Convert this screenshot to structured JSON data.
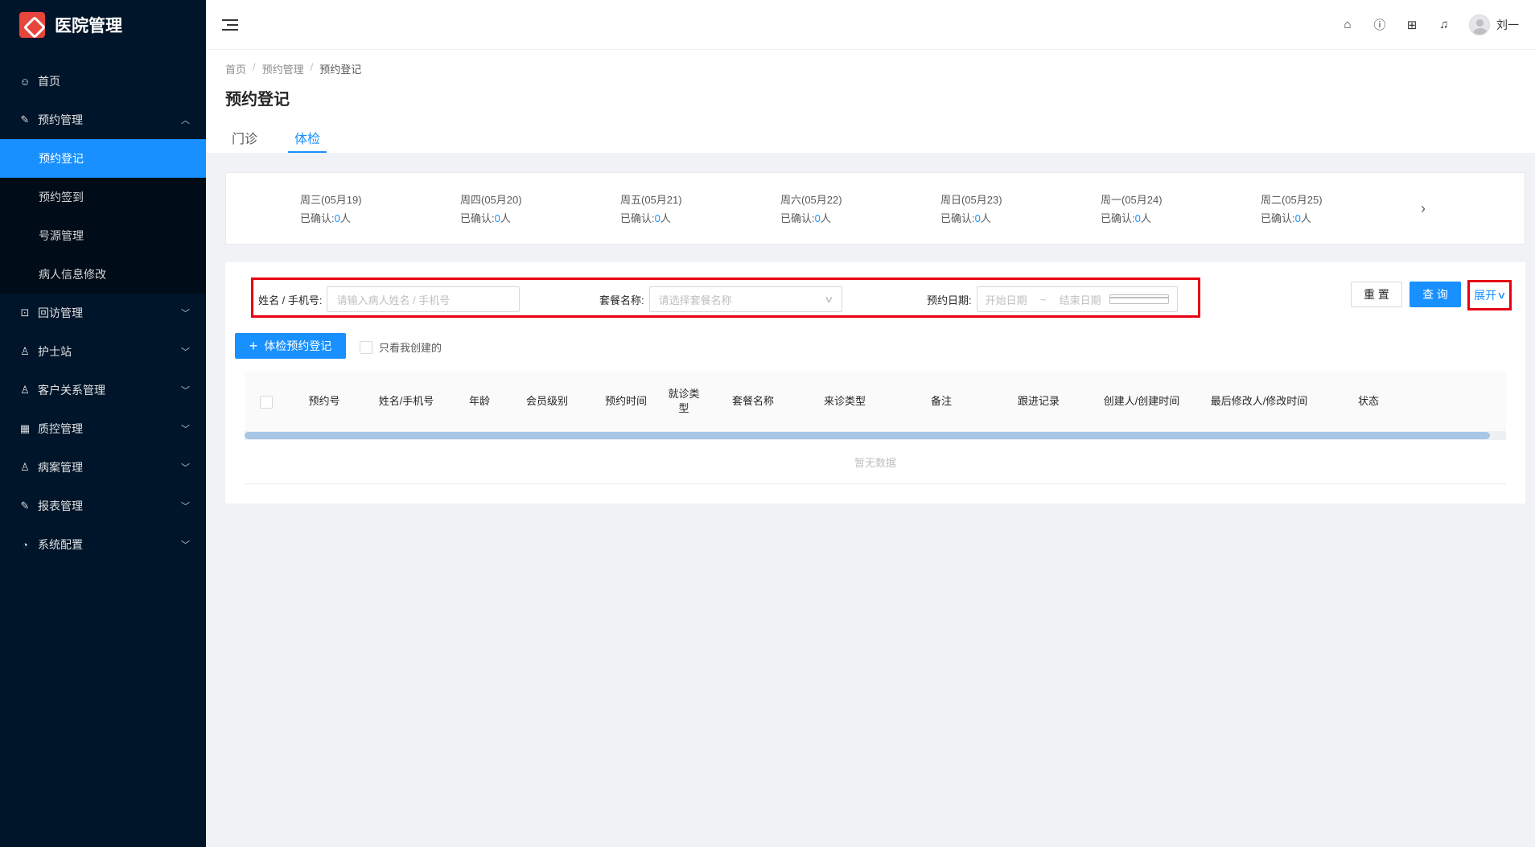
{
  "app": {
    "title": "医院管理"
  },
  "sidebar": {
    "items": [
      {
        "label": "首页",
        "icon": "smile-icon"
      },
      {
        "label": "预约管理",
        "icon": "edit-icon",
        "expanded": true,
        "children": [
          {
            "label": "预约登记",
            "active": true
          },
          {
            "label": "预约签到"
          },
          {
            "label": "号源管理"
          },
          {
            "label": "病人信息修改"
          }
        ]
      },
      {
        "label": "回访管理",
        "icon": "lock-icon"
      },
      {
        "label": "护士站",
        "icon": "user-icon"
      },
      {
        "label": "客户关系管理",
        "icon": "user-icon"
      },
      {
        "label": "质控管理",
        "icon": "table-icon"
      },
      {
        "label": "病案管理",
        "icon": "user-icon"
      },
      {
        "label": "报表管理",
        "icon": "edit-icon"
      },
      {
        "label": "系统配置",
        "icon": "dashboard-icon"
      }
    ]
  },
  "header": {
    "username": "刘一"
  },
  "breadcrumb": [
    "首页",
    "预约管理",
    "预约登记"
  ],
  "page_title": "预约登记",
  "tabs": [
    {
      "label": "门诊",
      "active": false
    },
    {
      "label": "体检",
      "active": true
    }
  ],
  "dates": [
    {
      "label": "周三(05月19)",
      "confirmed_prefix": "已确认:",
      "count": "0",
      "unit": "人"
    },
    {
      "label": "周四(05月20)",
      "confirmed_prefix": "已确认:",
      "count": "0",
      "unit": "人"
    },
    {
      "label": "周五(05月21)",
      "confirmed_prefix": "已确认:",
      "count": "0",
      "unit": "人"
    },
    {
      "label": "周六(05月22)",
      "confirmed_prefix": "已确认:",
      "count": "0",
      "unit": "人"
    },
    {
      "label": "周日(05月23)",
      "confirmed_prefix": "已确认:",
      "count": "0",
      "unit": "人"
    },
    {
      "label": "周一(05月24)",
      "confirmed_prefix": "已确认:",
      "count": "0",
      "unit": "人"
    },
    {
      "label": "周二(05月25)",
      "confirmed_prefix": "已确认:",
      "count": "0",
      "unit": "人"
    }
  ],
  "search": {
    "name_label": "姓名 / 手机号:",
    "name_placeholder": "请输入病人姓名 / 手机号",
    "package_label": "套餐名称:",
    "package_placeholder": "请选择套餐名称",
    "date_label": "预约日期:",
    "start_placeholder": "开始日期",
    "range_separator": "~",
    "end_placeholder": "结束日期"
  },
  "buttons": {
    "reset": "重 置",
    "query": "查 询",
    "expand": "展开",
    "add": "体检预约登记"
  },
  "only_mine_label": "只看我创建的",
  "table": {
    "columns": [
      "预约号",
      "姓名/手机号",
      "年龄",
      "会员级别",
      "预约时间",
      "就诊类型",
      "套餐名称",
      "来诊类型",
      "备注",
      "跟进记录",
      "创建人/创建时间",
      "最后修改人/修改时间",
      "状态"
    ],
    "empty_text": "暂无数据"
  },
  "colors": {
    "sidebar_bg": "#001529",
    "primary": "#1890ff",
    "highlight_border": "#e60012",
    "logo": "#e8453c"
  }
}
